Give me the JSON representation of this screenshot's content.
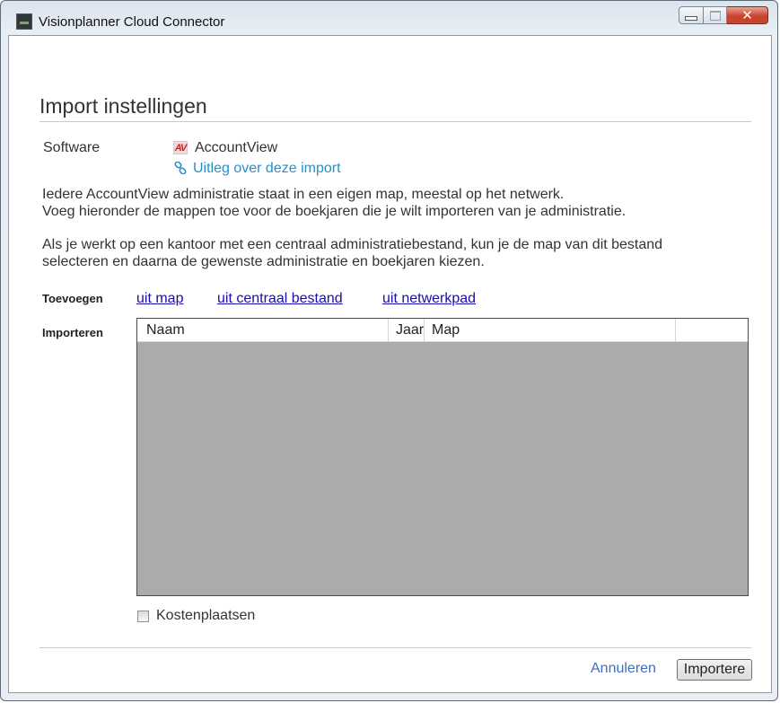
{
  "window": {
    "title": "Visionplanner Cloud Connector",
    "icon": "app-icon",
    "controls": [
      "minimize",
      "maximize",
      "close"
    ]
  },
  "page": {
    "heading": "Import instellingen"
  },
  "software": {
    "label": "Software",
    "name": "AccountView",
    "logo_text": "AV",
    "logo_color": "#cc2222",
    "info_link": "Uitleg over deze import",
    "link_color": "#2a8fc9"
  },
  "description": {
    "line1": "Iedere AccountView administratie staat in een eigen map, meestal op het netwerk.",
    "line2": "Voeg hieronder de mappen toe voor de boekjaren die je wilt importeren van je administratie.",
    "line3": "Als je werkt op een kantoor met een centraal administratiebestand, kun je de map van dit bestand",
    "line4": "selecteren en daarna de gewenste administratie en boekjaren kiezen."
  },
  "toevoegen": {
    "label": "Toevoegen",
    "links": [
      "uit map",
      "uit centraal bestand",
      "uit netwerkpad"
    ]
  },
  "importeren": {
    "label": "Importeren",
    "columns": [
      "Naam",
      "Jaar",
      "Map",
      ""
    ],
    "rows": []
  },
  "options": {
    "kostenplaatsen_label": "Kostenplaatsen",
    "kostenplaatsen_checked": false
  },
  "footer": {
    "cancel_label": "Annuleren",
    "import_label": "Importere"
  }
}
